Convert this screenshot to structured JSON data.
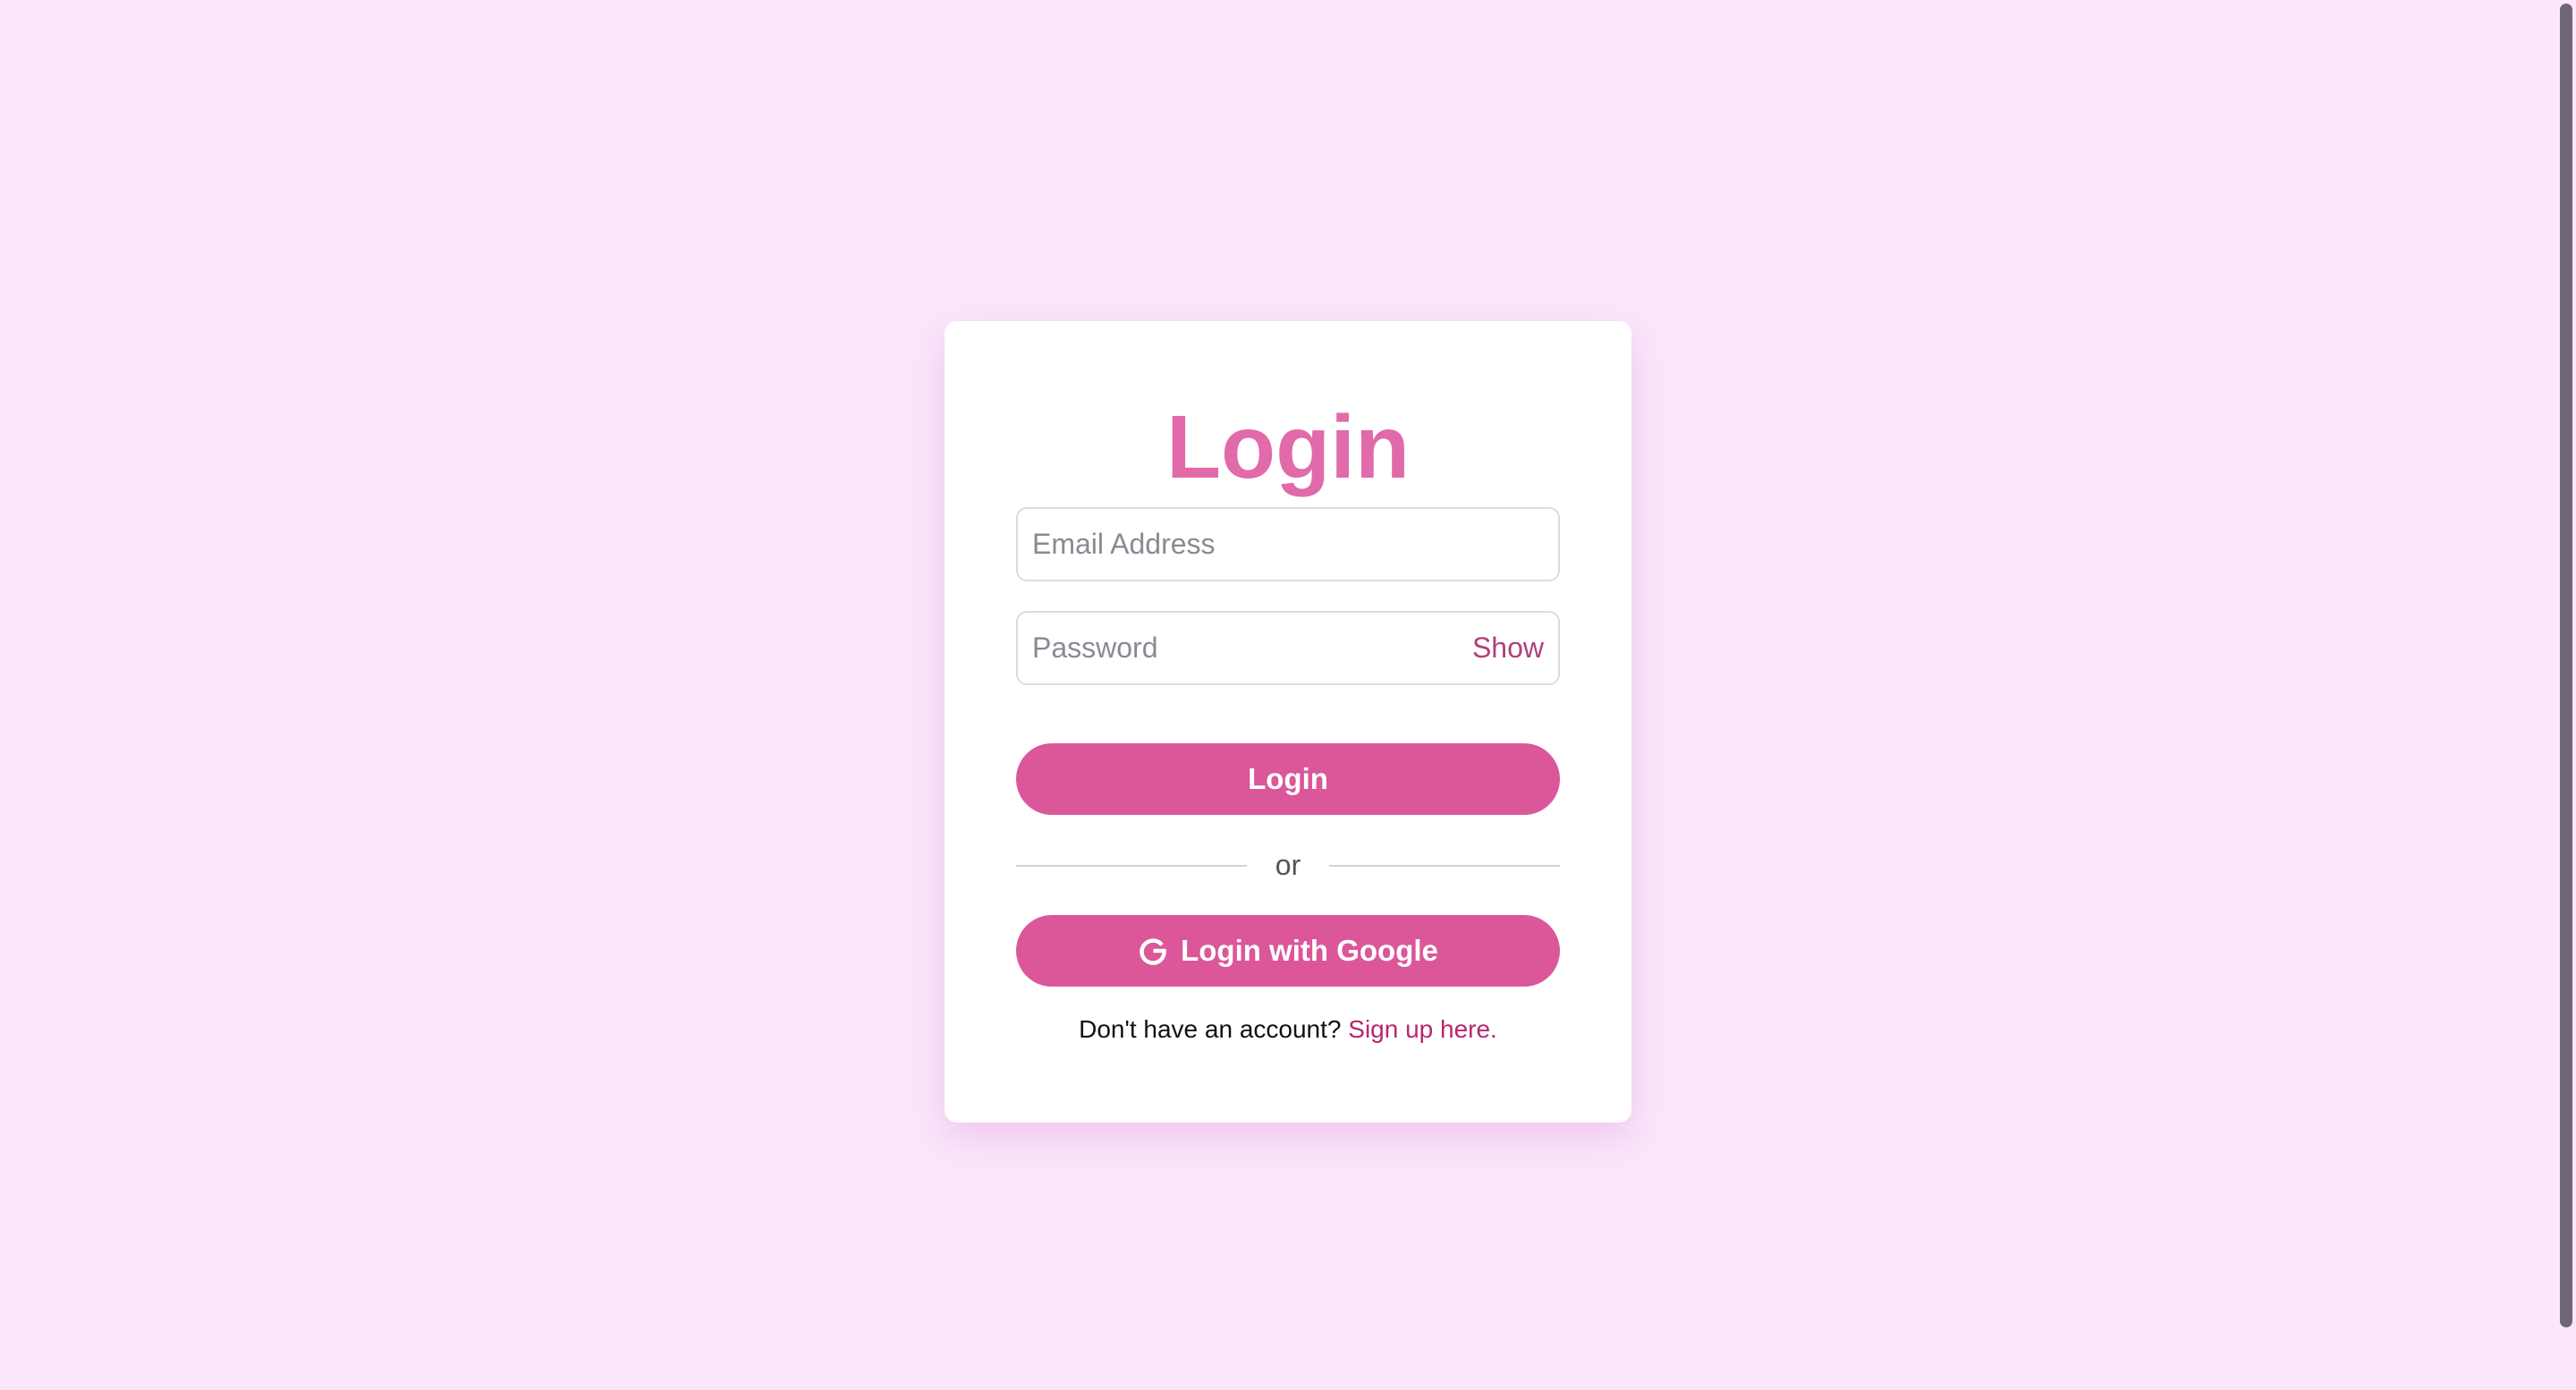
{
  "login_card": {
    "title": "Login",
    "email": {
      "placeholder": "Email Address",
      "value": ""
    },
    "password": {
      "placeholder": "Password",
      "value": "",
      "toggle_label": "Show"
    },
    "login_button_label": "Login",
    "divider_text": "or",
    "google_button_label": "Login with Google",
    "google_icon": "google-g-icon",
    "signup_prompt": "Don't have an account?",
    "signup_link": "Sign up here."
  },
  "colors": {
    "background": "#fbe6fb",
    "accent": "#db5799",
    "title": "#e06aaa",
    "link": "#b8276e"
  }
}
